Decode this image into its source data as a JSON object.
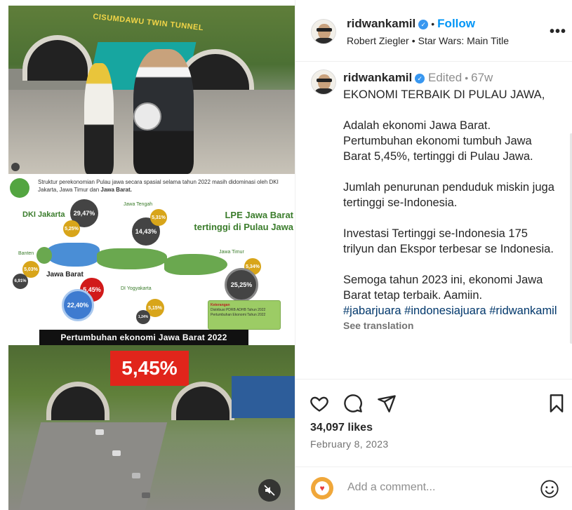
{
  "header": {
    "username": "ridwankamil",
    "follow_label": "Follow",
    "music_artist": "Robert Ziegler",
    "music_title": "Star Wars: Main Title",
    "more_label": "•••"
  },
  "caption": {
    "username": "ridwankamil",
    "edited": "Edited",
    "age": "67w",
    "text": "EKONOMI TERBAIK DI PULAU JAWA,\n\nAdalah ekonomi Jawa Barat. Pertumbuhan ekonomi tumbuh Jawa Barat 5,45%, tertinggi di Pulau Jawa.\n\nJumlah penurunan penduduk miskin juga tertinggi se-Indonesia.\n\nInvestasi Tertinggi se-Indonesia 175 trilyun dan Ekspor terbesar se Indonesia.\n\nSemoga tahun 2023 ini, ekonomi Jawa Barat tetap terbaik. Aamiin.\n",
    "hashtags": "#jabarjuara #indonesiajuara #ridwankamil",
    "see_translation": "See translation"
  },
  "post": {
    "likes": "34,097 likes",
    "date": "February 8, 2023"
  },
  "comment": {
    "placeholder": "Add a comment..."
  },
  "media": {
    "tunnel_sign": "CISUMDAWU TWIN TUNNEL",
    "info_desc_1": "Struktur perekonomian Pulau jawa secara spasial selama tahun 2022 masih didominasi oleh DKI Jakarta, Jawa Timur dan ",
    "info_desc_bold": "Jawa Barat.",
    "lpe_line1": "LPE Jawa Barat",
    "lpe_line2": "tertinggi di Pulau Jawa",
    "dki_label": "DKI Jakarta",
    "dki_big": "29,47%",
    "dki_small": "5,25%",
    "jateng_label": "Jawa Tengah",
    "jateng_big": "14,43%",
    "jateng_small": "5,31%",
    "banten_label": "Banten",
    "banten_small": "5,03%",
    "banten_big": "6,91%",
    "jabar_label": "Jawa Barat",
    "jabar_red": "5,45%",
    "jabar_big": "22,40%",
    "diy_label": "DI Yogyakarta",
    "diy_small": "5,15%",
    "diy_big": "1,24%",
    "jatim_label": "Jawa Timur",
    "jatim_small": "5,34%",
    "jatim_big": "25,25%",
    "legend_title": "Keterangan",
    "legend_1": "Distribusi PDRB ADHB Tahun 2022",
    "legend_2": "Pertumbuhan Ekonomi Tahun 2022",
    "banner": "Pertumbuhan ekonomi Jawa Barat 2022",
    "red_value": "5,45%"
  },
  "colors": {
    "accent": "#0095f6",
    "verified": "#3897f0",
    "hashtag": "#00376b",
    "red": "#e1251b"
  }
}
